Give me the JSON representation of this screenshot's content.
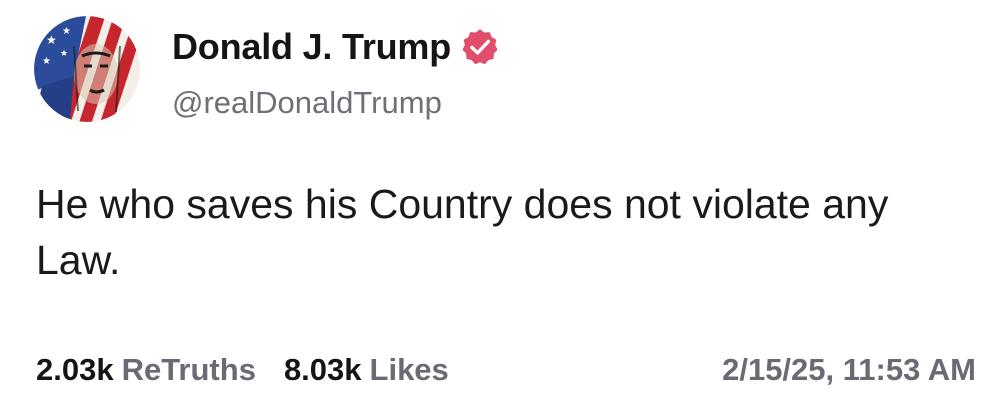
{
  "author": {
    "display_name": "Donald J. Trump",
    "handle": "@realDonaldTrump",
    "verified": true,
    "verified_color": "#e14d6a"
  },
  "post": {
    "text": "He who saves his Country does not violate any Law."
  },
  "stats": {
    "retruths_count": "2.03k",
    "retruths_label": "ReTruths",
    "likes_count": "8.03k",
    "likes_label": "Likes"
  },
  "timestamp": "2/15/25, 11:53 AM",
  "icons": {
    "avatar": "avatar-flag-portrait",
    "verified": "verified-badge-icon"
  }
}
